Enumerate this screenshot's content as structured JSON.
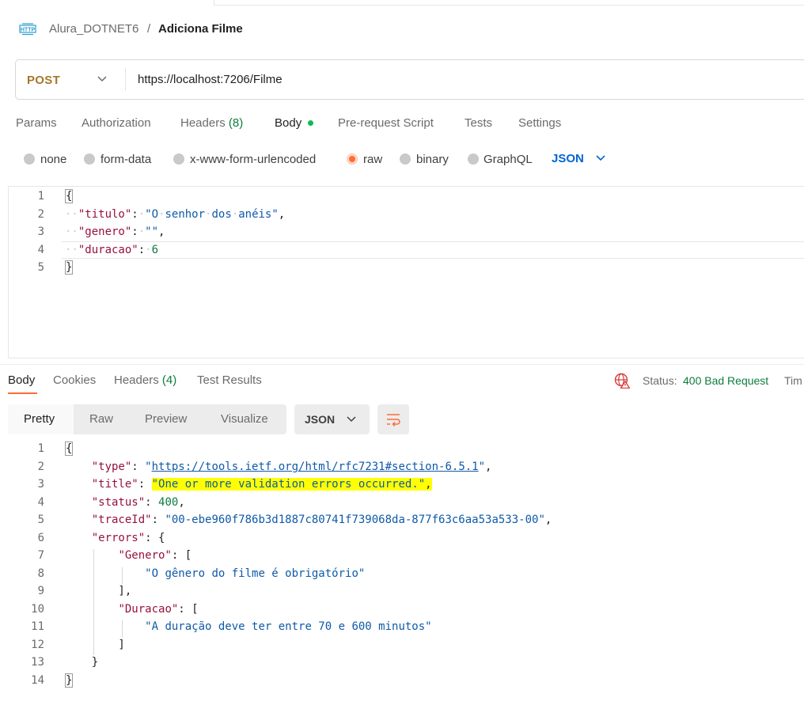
{
  "breadcrumb": {
    "collection": "Alura_DOTNET6",
    "separator": "/",
    "request_name": "Adiciona Filme"
  },
  "request": {
    "method": "POST",
    "url": "https://localhost:7206/Filme",
    "tabs": [
      {
        "label": "Params"
      },
      {
        "label": "Authorization"
      },
      {
        "label": "Headers",
        "count": "(8)"
      },
      {
        "label": "Body"
      },
      {
        "label": "Pre-request Script"
      },
      {
        "label": "Tests"
      },
      {
        "label": "Settings"
      }
    ],
    "body_types": [
      "none",
      "form-data",
      "x-www-form-urlencoded",
      "raw",
      "binary",
      "GraphQL"
    ],
    "body_format": "JSON",
    "line_numbers": [
      "1",
      "2",
      "3",
      "4",
      "5"
    ]
  },
  "response": {
    "tabs": [
      {
        "label": "Body"
      },
      {
        "label": "Cookies"
      },
      {
        "label": "Headers",
        "count": "(4)"
      },
      {
        "label": "Test Results"
      }
    ],
    "status_label": "Status:",
    "status_value": "400 Bad Request",
    "time_label": "Tim",
    "views": [
      "Pretty",
      "Raw",
      "Preview",
      "Visualize"
    ],
    "format": "JSON",
    "line_numbers": [
      "1",
      "2",
      "3",
      "4",
      "5",
      "6",
      "7",
      "8",
      "9",
      "10",
      "11",
      "12",
      "13",
      "14"
    ]
  },
  "icons": {
    "http": "http-icon",
    "method_dropdown": "chevron-down-icon",
    "status_error": "globe-error-icon",
    "wrap": "wrap-lines-icon"
  },
  "colors": {
    "method_post": "#A5782A",
    "accent": "#ff6c37",
    "status_ok_text": "#0d7d3d",
    "json_key": "#97113c",
    "json_string": "#0f5aa8"
  }
}
